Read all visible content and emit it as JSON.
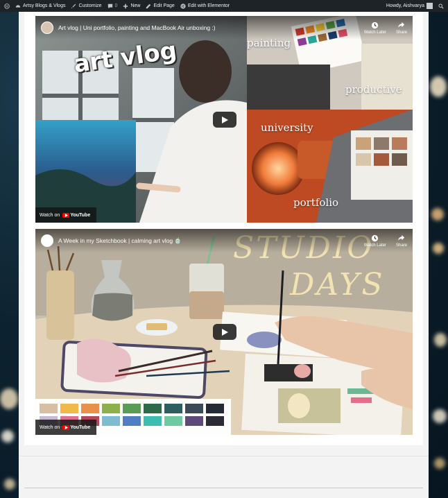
{
  "adminbar": {
    "site_name": "Artsy Blogs & Vlogs",
    "customize": "Customize",
    "comments_count": "0",
    "new": "New",
    "edit_page": "Edit Page",
    "edit_elementor": "Edit with Elementor",
    "howdy": "Howdy, Aishvarya"
  },
  "videos": [
    {
      "title": "Art vlog | Uni portfolio, painting and MacBook Air unboxing :)",
      "watch_later": "Watch Later",
      "share": "Share",
      "watch_on": "Watch on",
      "youtube": "YouTube",
      "words": {
        "art_vlog": "art vlog",
        "painting": "painting",
        "productive": "productive",
        "university": "university",
        "portfolio": "portfolio"
      }
    },
    {
      "title": "A Week in my Sketchbook | calming art vlog 🍵",
      "watch_later": "Watch Later",
      "share": "Share",
      "watch_on": "Watch on",
      "youtube": "YouTube",
      "words": {
        "studio": "STUDIO",
        "days": "DAYS"
      }
    }
  ]
}
